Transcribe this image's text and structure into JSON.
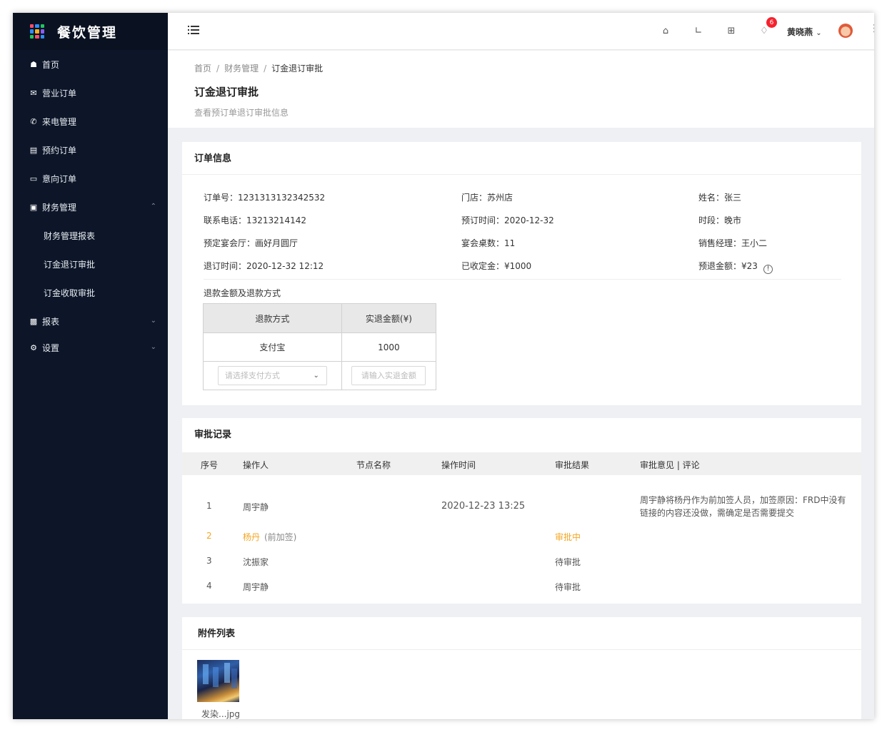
{
  "app": {
    "title": "餐饮管理"
  },
  "sidebar": {
    "items": [
      {
        "label": "首页",
        "icon": "home-icon"
      },
      {
        "label": "营业订单",
        "icon": "mail-icon"
      },
      {
        "label": "来电管理",
        "icon": "phone-icon"
      },
      {
        "label": "预约订单",
        "icon": "list-icon"
      },
      {
        "label": "意向订单",
        "icon": "monitor-icon"
      },
      {
        "label": "财务管理",
        "icon": "wallet-icon",
        "expanded": true,
        "children": [
          "财务管理报表",
          "订金退订审批",
          "订金收取审批"
        ]
      },
      {
        "label": "报表",
        "icon": "chart-icon"
      },
      {
        "label": "设置",
        "icon": "gear-icon"
      }
    ]
  },
  "header": {
    "notifications": "6",
    "username": "黄晓燕"
  },
  "page": {
    "breadcrumb": [
      "首页",
      "财务管理",
      "订金退订审批"
    ],
    "title": "订金退订审批",
    "subtitle": "查看预订单退订审批信息"
  },
  "order": {
    "card_title": "订单信息",
    "fields": {
      "order_no": "订单号：1231313132342532",
      "store": "门店：苏州店",
      "name": "姓名：张三",
      "phone": "联系电话：13213214142",
      "book_time": "预订时间：2020-12-32",
      "period": "时段：晚市",
      "hall": "预定宴会厅：画好月圆厅",
      "tables": "宴会桌数：11",
      "manager": "销售经理：王小二",
      "cancel_time": "退订时间：2020-12-32 12:12",
      "deposit": "已收定金：¥1000",
      "refund_pre": "预退金额：¥23"
    },
    "refund_section": "退款金额及退款方式",
    "refund_table": {
      "headers": [
        "退款方式",
        "实退金额(¥)"
      ],
      "row": [
        "支付宝",
        "1000"
      ],
      "select_placeholder": "请选择支付方式",
      "input_placeholder": "请输入实退金额"
    }
  },
  "approval": {
    "card_title": "审批记录",
    "headers": [
      "序号",
      "操作人",
      "节点名称",
      "操作时间",
      "审批结果",
      "审批意见 | 评论"
    ],
    "rows": [
      {
        "no": "1",
        "operator": "周宇静",
        "time": "2020-12-23 13:25",
        "result": "",
        "comment1": "周宇静将杨丹作为前加签人员，加签原因：FRD中没有",
        "comment2": "链接的内容还没做，需确定是否需要提交"
      },
      {
        "no": "2",
        "operator": "杨丹",
        "operator_note": "(前加签)",
        "result": "审批中"
      },
      {
        "no": "3",
        "operator": "沈振家",
        "result": "待审批"
      },
      {
        "no": "4",
        "operator": "周宇静",
        "result": "待审批"
      }
    ]
  },
  "attachments": {
    "card_title": "附件列表",
    "files": [
      {
        "name": "发染...jpg"
      }
    ]
  },
  "colors": {
    "sidebar_bg": "#0c1628",
    "accent_orange": "#f5a623",
    "badge_red": "#f5222d"
  }
}
